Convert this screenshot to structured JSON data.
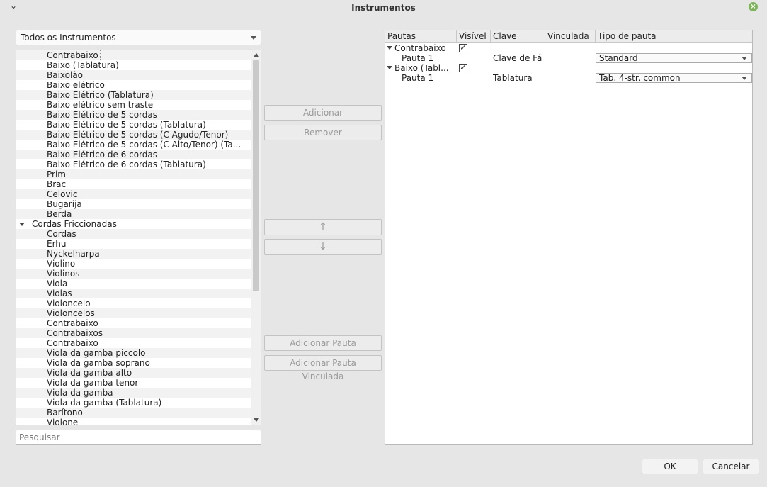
{
  "window": {
    "title": "Instrumentos",
    "menu_glyph": "⌄",
    "close_glyph": "×"
  },
  "filter": {
    "selected": "Todos os Instrumentos"
  },
  "search": {
    "placeholder": "Pesquisar"
  },
  "instrument_list": [
    {
      "label": "Contrabaixo",
      "type": "child",
      "selected": true
    },
    {
      "label": "Baixo (Tablatura)",
      "type": "child"
    },
    {
      "label": "Baixolão",
      "type": "child"
    },
    {
      "label": "Baixo elétrico",
      "type": "child"
    },
    {
      "label": "Baixo Elétrico (Tablatura)",
      "type": "child"
    },
    {
      "label": "Baixo elétrico sem traste",
      "type": "child"
    },
    {
      "label": "Baixo Elétrico de 5 cordas",
      "type": "child"
    },
    {
      "label": "Baixo Elétrico de 5 cordas (Tablatura)",
      "type": "child"
    },
    {
      "label": "Baixo Elétrico de 5 cordas (C Agudo/Tenor)",
      "type": "child"
    },
    {
      "label": "Baixo Elétrico de 5 cordas (C Alto/Tenor) (Ta...",
      "type": "child"
    },
    {
      "label": "Baixo Elétrico de 6 cordas",
      "type": "child"
    },
    {
      "label": "Baixo Elétrico de 6 cordas (Tablatura)",
      "type": "child"
    },
    {
      "label": "Prim",
      "type": "child"
    },
    {
      "label": "Brac",
      "type": "child"
    },
    {
      "label": "Celovic",
      "type": "child"
    },
    {
      "label": "Bugarija",
      "type": "child"
    },
    {
      "label": "Berda",
      "type": "child"
    },
    {
      "label": "Cordas Friccionadas",
      "type": "group"
    },
    {
      "label": "Cordas",
      "type": "child"
    },
    {
      "label": "Erhu",
      "type": "child"
    },
    {
      "label": "Nyckelharpa",
      "type": "child"
    },
    {
      "label": "Violino",
      "type": "child"
    },
    {
      "label": "Violinos",
      "type": "child"
    },
    {
      "label": "Viola",
      "type": "child"
    },
    {
      "label": "Violas",
      "type": "child"
    },
    {
      "label": "Violoncelo",
      "type": "child"
    },
    {
      "label": "Violoncelos",
      "type": "child"
    },
    {
      "label": "Contrabaixo",
      "type": "child"
    },
    {
      "label": "Contrabaixos",
      "type": "child"
    },
    {
      "label": "Contrabaixo",
      "type": "child"
    },
    {
      "label": "Viola da gamba piccolo",
      "type": "child"
    },
    {
      "label": "Viola da gamba soprano",
      "type": "child"
    },
    {
      "label": "Viola da gamba alto",
      "type": "child"
    },
    {
      "label": "Viola da gamba tenor",
      "type": "child"
    },
    {
      "label": "Viola da gamba",
      "type": "child"
    },
    {
      "label": "Viola da gamba (Tablatura)",
      "type": "child"
    },
    {
      "label": "Barítono",
      "type": "child"
    },
    {
      "label": "Violone",
      "type": "child"
    }
  ],
  "buttons": {
    "add": "Adicionar",
    "remove": "Remover",
    "up": "↑",
    "down": "↓",
    "add_staff": "Adicionar Pauta",
    "add_linked_staff": "Adicionar Pauta Vinculada",
    "ok": "OK",
    "cancel": "Cancelar"
  },
  "staff_table": {
    "headers": [
      "Pautas",
      "Visível",
      "Clave",
      "Vinculada",
      "Tipo de pauta"
    ],
    "rows": [
      {
        "kind": "instrument",
        "name": "Contrabaixo",
        "visible": true,
        "clef": "",
        "linked": "",
        "type": ""
      },
      {
        "kind": "staff",
        "name": "Pauta 1",
        "visible": null,
        "clef": "Clave de Fá",
        "linked": "",
        "type": "Standard"
      },
      {
        "kind": "instrument",
        "name": "Baixo (Tabl...",
        "visible": true,
        "clef": "",
        "linked": "",
        "type": ""
      },
      {
        "kind": "staff",
        "name": "Pauta 1",
        "visible": null,
        "clef": "Tablatura",
        "linked": "",
        "type": "Tab. 4-str. common"
      }
    ],
    "check_glyph": "✓"
  }
}
